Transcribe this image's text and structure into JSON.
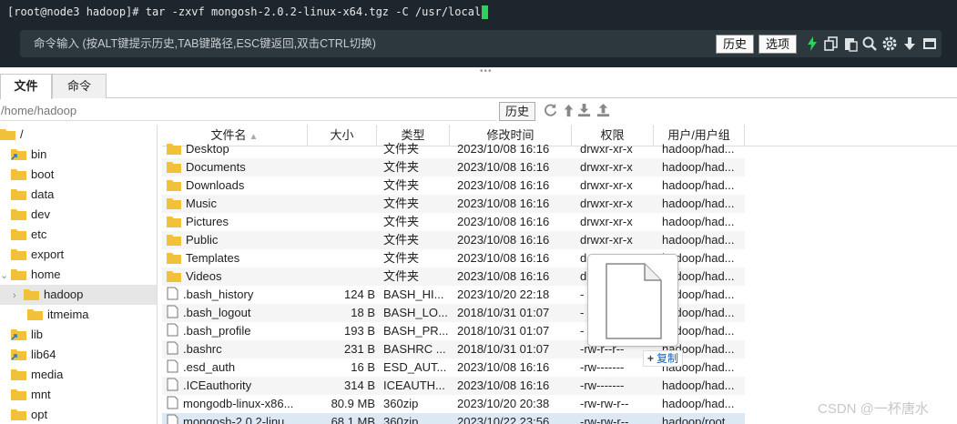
{
  "terminal": {
    "prompt_line": "[root@node3 hadoop]# tar -zxvf mongosh-2.0.2-linux-x64.tgz -C /usr/local",
    "cursor_color": "#2fd15a"
  },
  "command_bar": {
    "hint": "命令输入 (按ALT键提示历史,TAB键路径,ESC键返回,双击CTRL切换)",
    "history_label": "历史",
    "options_label": "选项",
    "icons": [
      "lightning-icon",
      "copy-icon",
      "paste-icon",
      "search-icon",
      "gear-icon",
      "arrow-down-icon",
      "window-icon"
    ]
  },
  "tabs": [
    {
      "label": "文件",
      "active": true
    },
    {
      "label": "命令",
      "active": false
    }
  ],
  "pathbar": {
    "path": "/home/hadoop",
    "history_label": "历史",
    "icons": [
      "refresh-icon",
      "up-icon",
      "download-icon",
      "upload-icon"
    ]
  },
  "tree": {
    "items": [
      {
        "label": "/"
      },
      {
        "label": "bin"
      },
      {
        "label": "boot"
      },
      {
        "label": "data"
      },
      {
        "label": "dev"
      },
      {
        "label": "etc"
      },
      {
        "label": "export"
      },
      {
        "label": "home"
      },
      {
        "label": "hadoop"
      },
      {
        "label": "itmeima"
      },
      {
        "label": "lib"
      },
      {
        "label": "lib64"
      },
      {
        "label": "media"
      },
      {
        "label": "mnt"
      },
      {
        "label": "opt"
      }
    ]
  },
  "table": {
    "headers": {
      "name": "文件名",
      "size": "大小",
      "type": "类型",
      "mtime": "修改时间",
      "perm": "权限",
      "owner": "用户/用户组"
    },
    "rows": [
      {
        "name": "Desktop",
        "size": "",
        "type": "文件夹",
        "mtime": "2023/10/08 16:16",
        "perm": "drwxr-xr-x",
        "owner": "hadoop/had...",
        "kind": "folder"
      },
      {
        "name": "Documents",
        "size": "",
        "type": "文件夹",
        "mtime": "2023/10/08 16:16",
        "perm": "drwxr-xr-x",
        "owner": "hadoop/had...",
        "kind": "folder"
      },
      {
        "name": "Downloads",
        "size": "",
        "type": "文件夹",
        "mtime": "2023/10/08 16:16",
        "perm": "drwxr-xr-x",
        "owner": "hadoop/had...",
        "kind": "folder"
      },
      {
        "name": "Music",
        "size": "",
        "type": "文件夹",
        "mtime": "2023/10/08 16:16",
        "perm": "drwxr-xr-x",
        "owner": "hadoop/had...",
        "kind": "folder"
      },
      {
        "name": "Pictures",
        "size": "",
        "type": "文件夹",
        "mtime": "2023/10/08 16:16",
        "perm": "drwxr-xr-x",
        "owner": "hadoop/had...",
        "kind": "folder"
      },
      {
        "name": "Public",
        "size": "",
        "type": "文件夹",
        "mtime": "2023/10/08 16:16",
        "perm": "drwxr-xr-x",
        "owner": "hadoop/had...",
        "kind": "folder"
      },
      {
        "name": "Templates",
        "size": "",
        "type": "文件夹",
        "mtime": "2023/10/08 16:16",
        "perm": "d",
        "owner": "hadoop/had...",
        "kind": "folder"
      },
      {
        "name": "Videos",
        "size": "",
        "type": "文件夹",
        "mtime": "2023/10/08 16:16",
        "perm": "d",
        "owner": "hadoop/had...",
        "kind": "folder"
      },
      {
        "name": ".bash_history",
        "size": "124 B",
        "type": "BASH_HI...",
        "mtime": "2023/10/20 22:18",
        "perm": "-",
        "owner": "hadoop/had...",
        "kind": "file"
      },
      {
        "name": ".bash_logout",
        "size": "18 B",
        "type": "BASH_LO...",
        "mtime": "2018/10/31 01:07",
        "perm": "-",
        "owner": "hadoop/had...",
        "kind": "file"
      },
      {
        "name": ".bash_profile",
        "size": "193 B",
        "type": "BASH_PR...",
        "mtime": "2018/10/31 01:07",
        "perm": "-",
        "owner": "hadoop/had...",
        "kind": "file"
      },
      {
        "name": ".bashrc",
        "size": "231 B",
        "type": "BASHRC ...",
        "mtime": "2018/10/31 01:07",
        "perm": "-rw-r--r--",
        "owner": "hadoop/had...",
        "kind": "file"
      },
      {
        "name": ".esd_auth",
        "size": "16 B",
        "type": "ESD_AUT...",
        "mtime": "2023/10/08 16:16",
        "perm": "-rw-------",
        "owner": "hadoop/had...",
        "kind": "file"
      },
      {
        "name": ".ICEauthority",
        "size": "314 B",
        "type": "ICEAUTH...",
        "mtime": "2023/10/08 16:16",
        "perm": "-rw-------",
        "owner": "hadoop/had...",
        "kind": "file"
      },
      {
        "name": "mongodb-linux-x86...",
        "size": "80.9 MB",
        "type": "360zip",
        "mtime": "2023/10/20 20:38",
        "perm": "-rw-rw-r--",
        "owner": "hadoop/had...",
        "kind": "file"
      },
      {
        "name": "mongosh-2.0.2-linu...",
        "size": "68.1 MB",
        "type": "360zip",
        "mtime": "2023/10/22 23:56",
        "perm": "-rw-rw-r--",
        "owner": "hadoop/root",
        "kind": "file"
      }
    ]
  },
  "drag": {
    "copy_label": "复制"
  },
  "watermark": "CSDN @一杯唐水",
  "colors": {
    "terminal_bg": "#1d262c",
    "command_bar_bg": "#2c373e",
    "folder": "#f2c13a",
    "accent_green": "#2fd15a"
  }
}
